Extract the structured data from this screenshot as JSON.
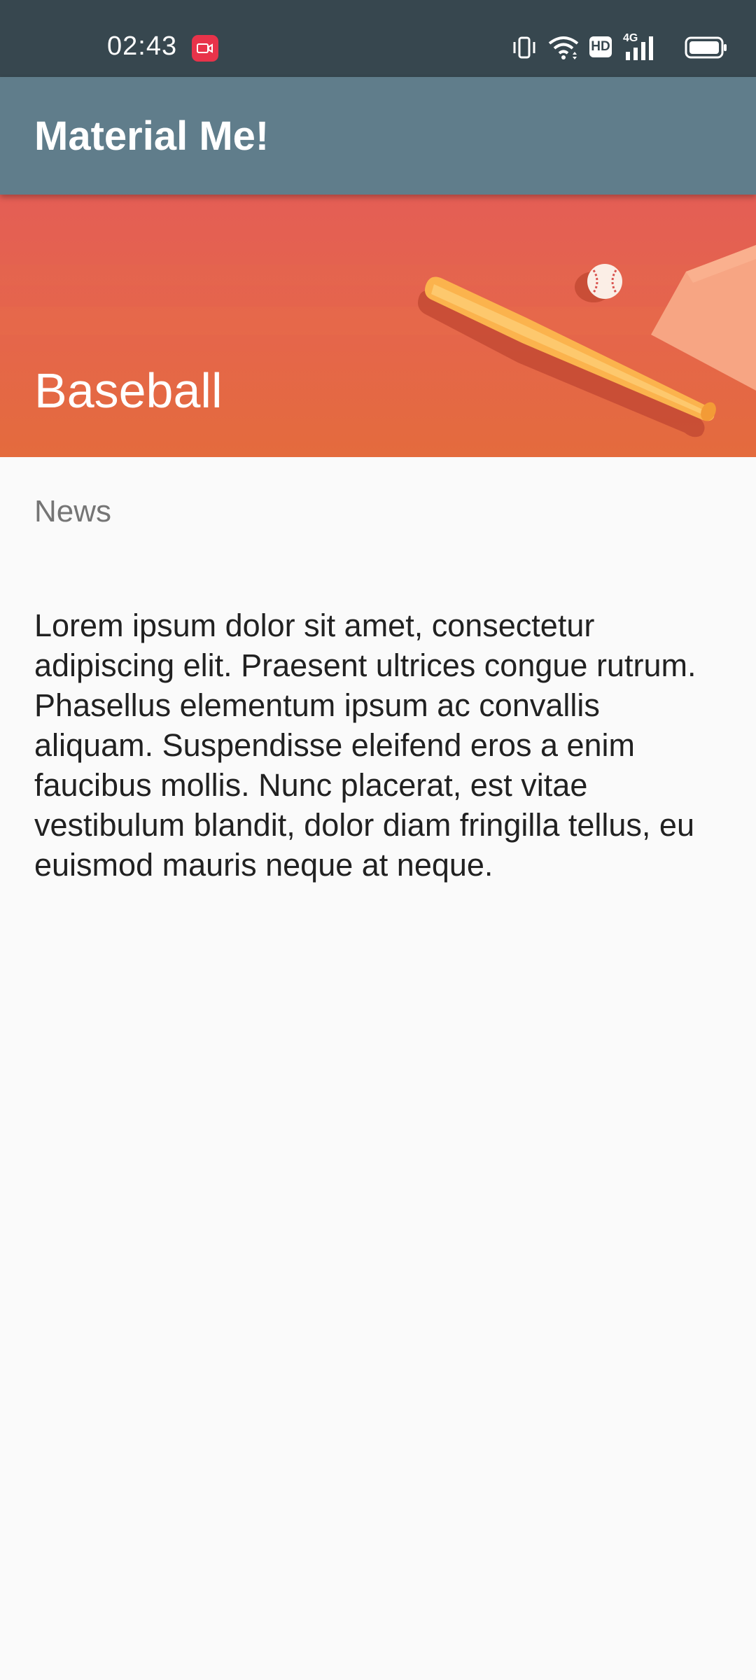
{
  "status_bar": {
    "time": "02:43",
    "icons": [
      "screen-record-icon",
      "vibrate-icon",
      "wifi-icon",
      "hd-icon",
      "4g-signal-icon",
      "battery-icon"
    ],
    "hd_label": "HD",
    "network_label": "4G"
  },
  "app_bar": {
    "title": "Material Me!",
    "color": "#607d8b"
  },
  "header": {
    "title": "Baseball",
    "image": "baseball-bat-and-ball-illustration",
    "color": "#e5664a"
  },
  "content": {
    "subtitle": "News",
    "body": "Lorem ipsum dolor sit amet, consectetur adipiscing elit. Praesent ultrices congue rutrum. Phasellus elementum ipsum ac convallis aliquam. Suspendisse eleifend eros a enim faucibus mollis. Nunc placerat, est vitae vestibulum blandit, dolor diam fringilla tellus, eu euismod mauris neque at neque."
  },
  "colors": {
    "status_bar": "#37474f",
    "background": "#fafafa",
    "record_indicator": "#e8334a"
  }
}
